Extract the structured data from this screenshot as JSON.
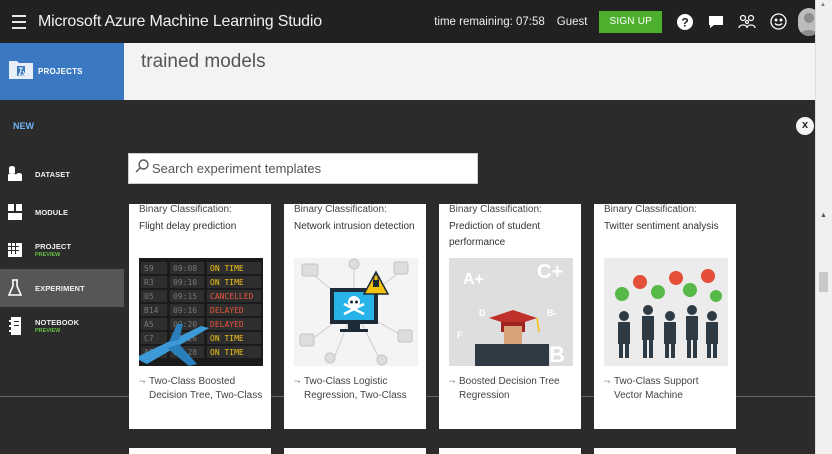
{
  "header": {
    "app_title": "Microsoft Azure Machine Learning Studio",
    "time_remaining": "time remaining: 07:58",
    "guest": "Guest",
    "signup": "SIGN UP"
  },
  "nav": {
    "projects": "PROJECTS"
  },
  "page": {
    "title": "trained models"
  },
  "modal": {
    "new_label": "NEW",
    "close": "x",
    "menu": [
      {
        "label": "DATASET",
        "preview": ""
      },
      {
        "label": "MODULE",
        "preview": ""
      },
      {
        "label": "PROJECT",
        "preview": "PREVIEW"
      },
      {
        "label": "EXPERIMENT",
        "preview": ""
      },
      {
        "label": "NOTEBOOK",
        "preview": "PREVIEW"
      }
    ],
    "search": {
      "placeholder": "Search experiment templates",
      "value": ""
    },
    "cards": [
      {
        "type": "Binary Classification:",
        "title": "Flight delay prediction",
        "algo1": "Two-Class Boosted",
        "algo2": "Decision Tree, Two-Class"
      },
      {
        "type": "Binary Classification:",
        "title": "Network intrusion detection",
        "algo1": "Two-Class Logistic",
        "algo2": "Regression, Two-Class"
      },
      {
        "type": "Binary Classification:",
        "title": "Prediction of student performance",
        "algo1": "Boosted Decision Tree",
        "algo2": "Regression"
      },
      {
        "type": "Binary Classification:",
        "title": "Twitter sentiment analysis",
        "algo1": "Two-Class Support",
        "algo2": "Vector Machine"
      }
    ],
    "flight_board": [
      {
        "a": "59",
        "b": "09:08",
        "status": "ON TIME"
      },
      {
        "a": "R3",
        "b": "09:10",
        "status": "ON TIME"
      },
      {
        "a": "05",
        "b": "09:15",
        "status": "CANCELLED"
      },
      {
        "a": "B14",
        "b": "09:16",
        "status": "DELAYED"
      },
      {
        "a": "A5",
        "b": "09:20",
        "status": "DELAYED"
      },
      {
        "a": "C7",
        "b": "09:26",
        "status": "ON TIME"
      },
      {
        "a": "A5",
        "b": "09:28",
        "status": "ON TIME"
      }
    ],
    "grades": {
      "a_plus": "A+",
      "c_plus": "C+",
      "d": "D",
      "b_minus": "B-",
      "f": "F",
      "b": "B"
    }
  },
  "colors": {
    "accent_blue": "#3b78c2",
    "signup_green": "#4caf2e",
    "preview_green": "#63c043",
    "new_blue": "#6fb2f4"
  }
}
